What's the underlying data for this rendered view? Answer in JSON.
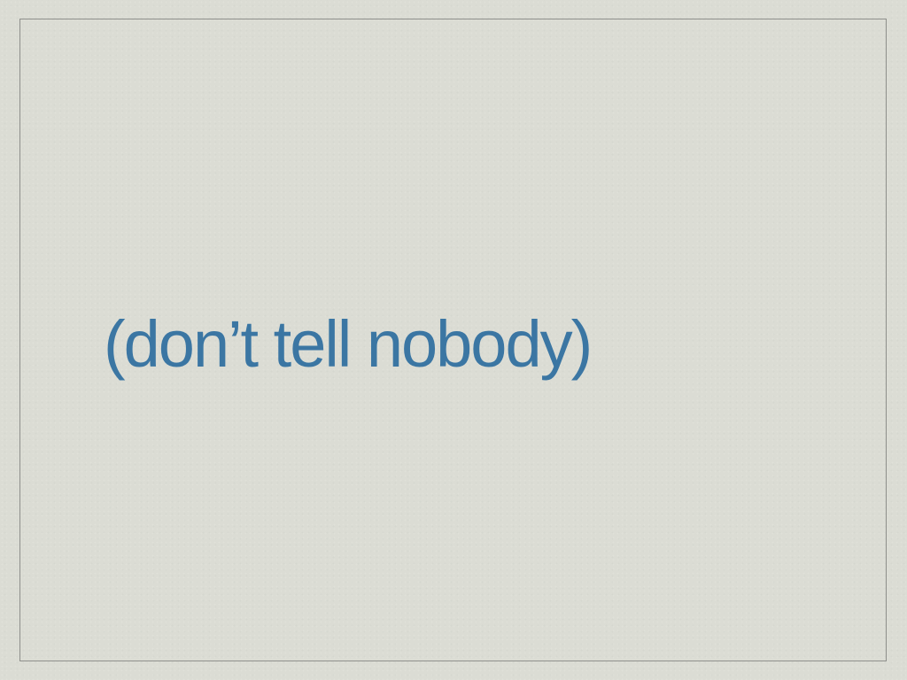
{
  "slide": {
    "text": "(don’t tell nobody)",
    "text_color": "#3b76a3",
    "background_color": "#dbdcd4",
    "frame_color": "#8e8f8b"
  }
}
